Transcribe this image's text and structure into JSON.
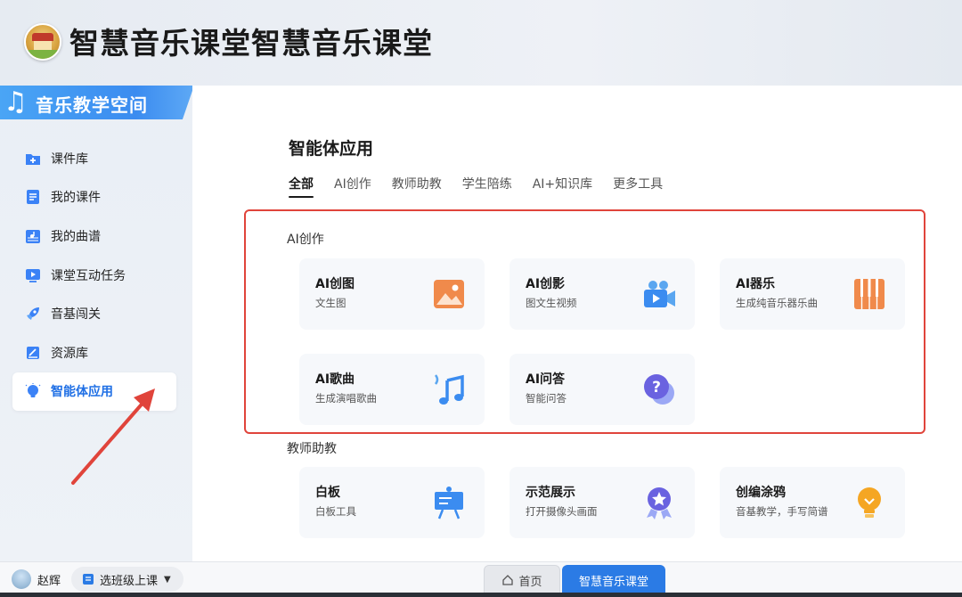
{
  "header": {
    "title": "智慧音乐课堂智慧音乐课堂"
  },
  "sidebar": {
    "space_label": "音乐教学空间",
    "items": [
      {
        "label": "课件库",
        "icon": "folder-plus-icon"
      },
      {
        "label": "我的课件",
        "icon": "document-icon"
      },
      {
        "label": "我的曲谱",
        "icon": "music-score-icon"
      },
      {
        "label": "课堂互动任务",
        "icon": "play-screen-icon"
      },
      {
        "label": "音基闯关",
        "icon": "rocket-icon"
      },
      {
        "label": "资源库",
        "icon": "resource-book-icon"
      },
      {
        "label": "智能体应用",
        "icon": "lightbulb-icon",
        "active": true
      }
    ]
  },
  "main": {
    "title": "智能体应用",
    "tabs": [
      {
        "label": "全部",
        "active": true
      },
      {
        "label": "AI创作"
      },
      {
        "label": "教师助教"
      },
      {
        "label": "学生陪练"
      },
      {
        "label": "AI+知识库"
      },
      {
        "label": "更多工具"
      }
    ],
    "sections": [
      {
        "title": "AI创作",
        "cards": [
          {
            "title": "AI创图",
            "subtitle": "文生图",
            "icon": "image-icon"
          },
          {
            "title": "AI创影",
            "subtitle": "图文生视频",
            "icon": "video-camera-icon"
          },
          {
            "title": "AI器乐",
            "subtitle": "生成纯音乐器乐曲",
            "icon": "piano-keys-icon"
          },
          {
            "title": "AI歌曲",
            "subtitle": "生成演唱歌曲",
            "icon": "music-notes-icon"
          },
          {
            "title": "AI问答",
            "subtitle": "智能问答",
            "icon": "question-chat-icon"
          }
        ]
      },
      {
        "title": "教师助教",
        "cards": [
          {
            "title": "白板",
            "subtitle": "白板工具",
            "icon": "whiteboard-icon"
          },
          {
            "title": "示范展示",
            "subtitle": "打开摄像头画面",
            "icon": "award-star-icon"
          },
          {
            "title": "创编涂鸦",
            "subtitle": "音基教学，手写简谱",
            "icon": "lightbulb-icon"
          }
        ]
      }
    ]
  },
  "bottom_bar": {
    "user_name": "赵辉",
    "class_select": "选班级上课",
    "home_tab": "首页",
    "active_tab": "智慧音乐课堂"
  },
  "colors": {
    "accent": "#2b7be5",
    "highlight_border": "#e0443b",
    "card_bg": "#f6f8fb"
  }
}
